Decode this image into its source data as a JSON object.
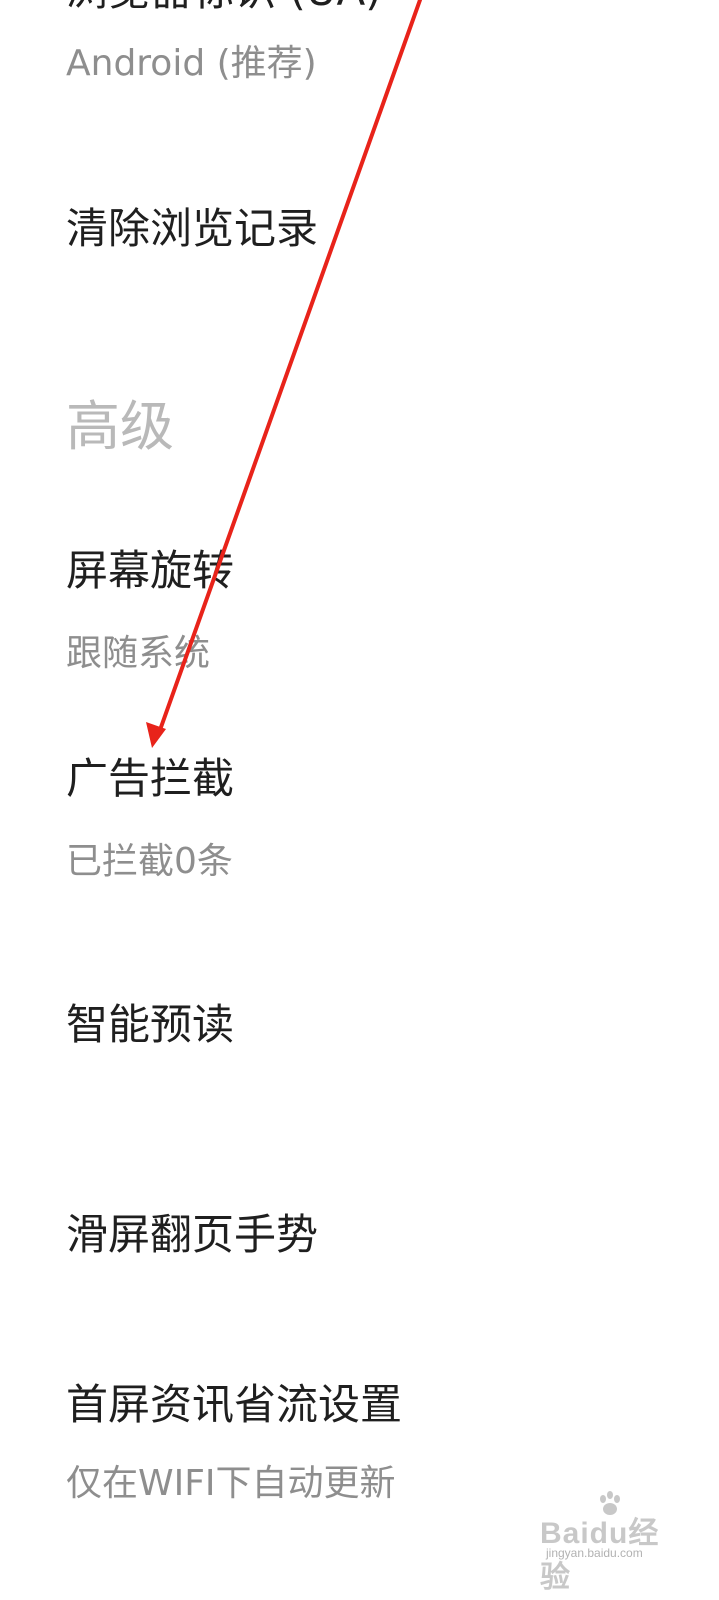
{
  "settings": {
    "partial_top_title": "浏览器标识 (UA)",
    "partial_top_value": "Android (推荐)",
    "clear_history": {
      "title": "清除浏览记录"
    },
    "advanced_section": {
      "header": "高级"
    },
    "screen_rotation": {
      "title": "屏幕旋转",
      "value": "跟随系统"
    },
    "ad_block": {
      "title": "广告拦截",
      "value": "已拦截0条"
    },
    "smart_preload": {
      "title": "智能预读"
    },
    "swipe_page_gesture": {
      "title": "滑屏翻页手势"
    },
    "homepage_data_saving": {
      "title": "首屏资讯省流设置",
      "value": "仅在WIFI下自动更新"
    }
  },
  "annotation": {
    "arrow_color": "#e8231a"
  },
  "watermark": {
    "brand": "Baidu经验",
    "url": "jingyan.baidu.com"
  }
}
